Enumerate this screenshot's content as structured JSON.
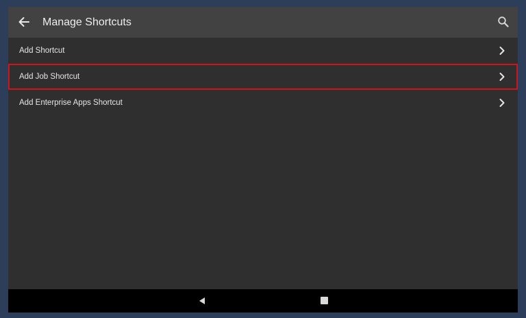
{
  "header": {
    "title": "Manage Shortcuts",
    "back_icon": "arrow-left-icon",
    "search_icon": "search-icon"
  },
  "list": {
    "items": [
      {
        "label": "Add Shortcut",
        "icon": "chevron-right-icon",
        "highlighted": false
      },
      {
        "label": "Add Job Shortcut",
        "icon": "chevron-right-icon",
        "highlighted": true
      },
      {
        "label": "Add Enterprise Apps Shortcut",
        "icon": "chevron-right-icon",
        "highlighted": false
      }
    ]
  },
  "navbar": {
    "back_icon": "nav-back-triangle-icon",
    "recents_icon": "nav-recents-square-icon"
  },
  "colors": {
    "frame_background": "#2c3e5a",
    "app_background": "#2f2f2f",
    "appbar_background": "#424242",
    "highlight_border": "#d0141b",
    "navbar_background": "#000000"
  }
}
